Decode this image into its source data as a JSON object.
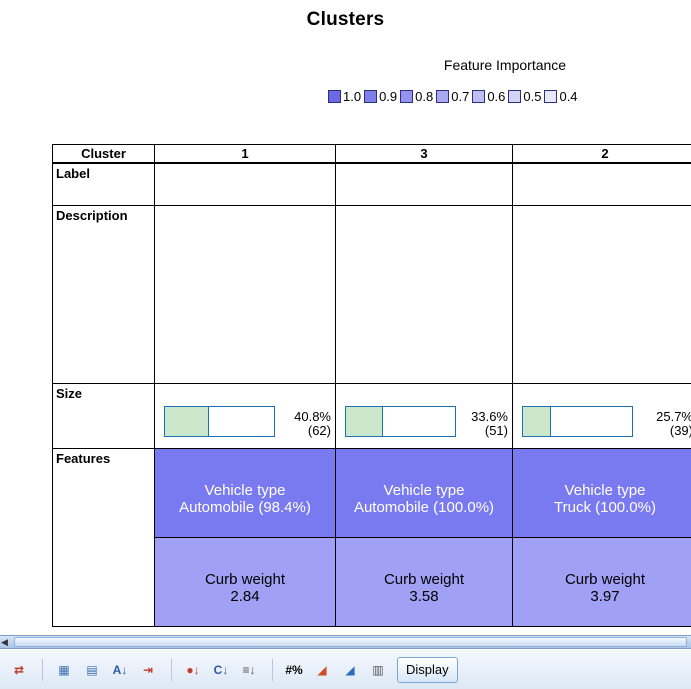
{
  "title": "Clusters",
  "feature_importance": {
    "title": "Feature Importance",
    "levels": [
      {
        "label": "1.0",
        "color": "#6a6ae6"
      },
      {
        "label": "0.9",
        "color": "#7f7fea"
      },
      {
        "label": "0.8",
        "color": "#9494ee"
      },
      {
        "label": "0.7",
        "color": "#a9a9f2"
      },
      {
        "label": "0.6",
        "color": "#bebef5"
      },
      {
        "label": "0.5",
        "color": "#d3d3f8"
      },
      {
        "label": "0.4",
        "color": "#e8e8fc"
      }
    ]
  },
  "table": {
    "header_label": "Cluster",
    "columns": [
      "1",
      "3",
      "2"
    ],
    "row_labels": {
      "label": "Label",
      "description": "Description",
      "size": "Size",
      "features": "Features"
    },
    "sizes": [
      {
        "percent": "40.8%",
        "count": "(62)",
        "fraction": 0.408
      },
      {
        "percent": "33.6%",
        "count": "(51)",
        "fraction": 0.336
      },
      {
        "percent": "25.7%",
        "count": "(39)",
        "fraction": 0.257
      }
    ],
    "features": [
      {
        "color": "#7a7af0",
        "cells": [
          {
            "name": "Vehicle type",
            "value": "Automobile (98.4%)"
          },
          {
            "name": "Vehicle type",
            "value": "Automobile (100.0%)"
          },
          {
            "name": "Vehicle type",
            "value": "Truck (100.0%)"
          }
        ]
      },
      {
        "color": "#a0a0f4",
        "cells": [
          {
            "name": "Curb weight",
            "value": "2.84"
          },
          {
            "name": "Curb weight",
            "value": "3.58"
          },
          {
            "name": "Curb weight",
            "value": "3.97"
          }
        ]
      }
    ]
  },
  "toolbar": {
    "display_label": "Display",
    "icons": [
      "transpose-icon",
      "sep",
      "grid-view-icon",
      "grid-alt-icon",
      "sort-az-icon",
      "sort-columns-icon",
      "sep",
      "sort-clusters-icon",
      "sort-features-icon",
      "sort-by-size-icon",
      "sep",
      "percent-icon",
      "chart-icon",
      "chart-alt-icon",
      "layout-icon"
    ]
  }
}
